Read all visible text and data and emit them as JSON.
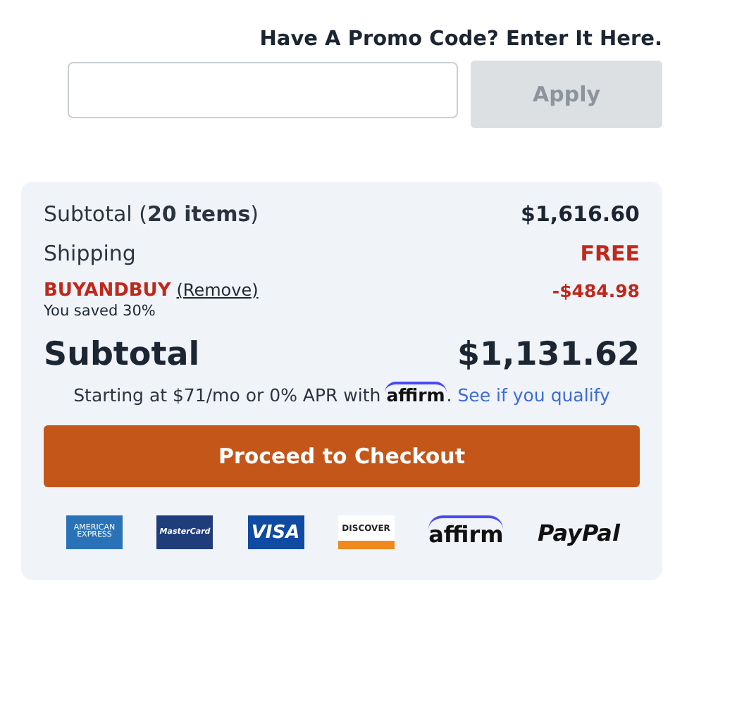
{
  "promo": {
    "heading": "Have A Promo Code? Enter It Here.",
    "button": {
      "label": "Apply",
      "disabled": true
    }
  },
  "summary": {
    "subtotal_label": "Subtotal (**20 items**)",
    "subtotal_value": "$1,616.60",
    "shipping_label": "Shipping",
    "shipping_value": "FREE",
    "coupon": {
      "code": "BUYANDBUY",
      "remove": "(Remove)",
      "note": "You saved 30%",
      "value": "-$484.98"
    },
    "total_label": "Subtotal",
    "total_value": "$1,131.62",
    "financing": {
      "text": "Starting at $71/mo or 0% APR with",
      "brand": "affirm",
      "after_brand": ".",
      "link": "See if you qualify"
    },
    "checkout": "Proceed to Checkout",
    "payment_methods": [
      {
        "kind": "amex",
        "label": "AMERICAN EXPRESS"
      },
      {
        "kind": "mastercard",
        "label": "MasterCard"
      },
      {
        "kind": "visa",
        "label": "VISA"
      },
      {
        "kind": "discover",
        "label": "DISCOVER"
      },
      {
        "kind": "affirm",
        "label": "affirm"
      },
      {
        "kind": "paypal",
        "label": "PayPal"
      }
    ]
  }
}
